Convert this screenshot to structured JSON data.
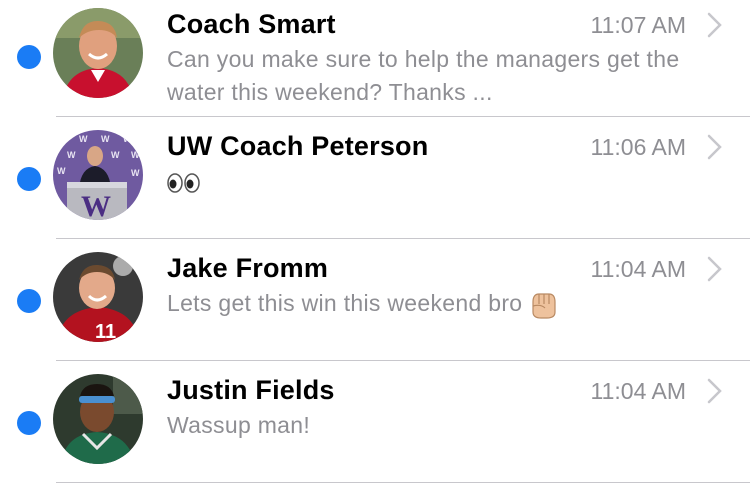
{
  "threads": [
    {
      "name": "Coach Smart",
      "time": "11:07 AM",
      "preview": "Can you make sure to help the managers get the water this weekend? Thanks ...",
      "unread": true,
      "avatar": "coach-smart-photo"
    },
    {
      "name": "UW Coach Peterson",
      "time": "11:06 AM",
      "preview": "",
      "preview_emoji": "eyes-emoji",
      "unread": true,
      "avatar": "uw-coach-peterson-photo"
    },
    {
      "name": "Jake Fromm",
      "time": "11:04 AM",
      "preview": "Lets get this win this weekend bro",
      "preview_emoji": "raised-fist-emoji",
      "unread": true,
      "avatar": "jake-fromm-photo"
    },
    {
      "name": "Justin Fields",
      "time": "11:04 AM",
      "preview": "Wassup man!",
      "unread": true,
      "avatar": "justin-fields-photo"
    }
  ],
  "colors": {
    "unread_dot": "#1a7cf5",
    "secondary_text": "#8e8e93",
    "separator": "#c8c7cc"
  }
}
